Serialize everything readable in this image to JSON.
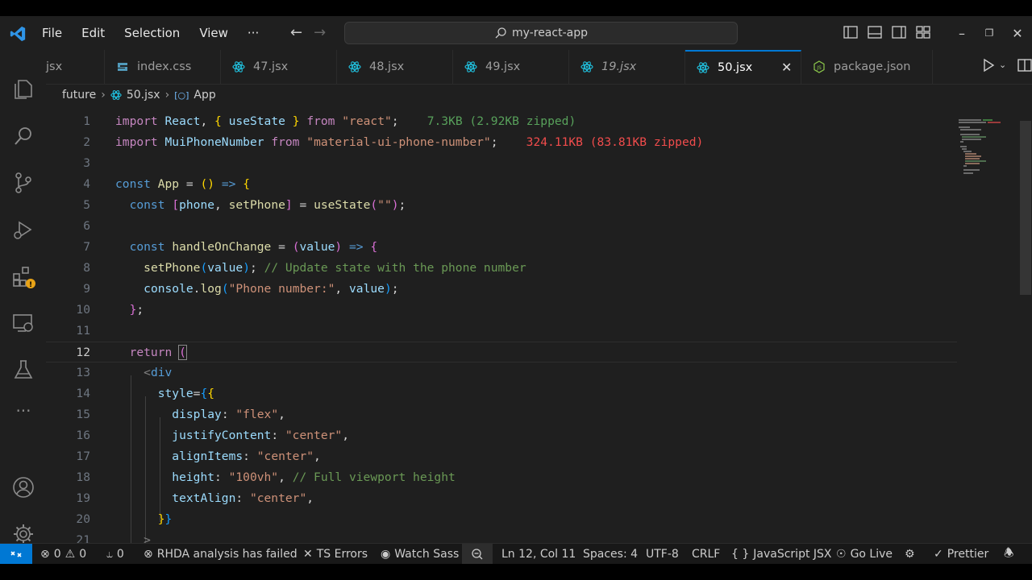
{
  "menu": [
    "File",
    "Edit",
    "Selection",
    "View",
    "···"
  ],
  "search": {
    "text": "my-react-app"
  },
  "tabs": [
    {
      "label": "jsx",
      "icon": "none"
    },
    {
      "label": "index.css",
      "icon": "css-icon"
    },
    {
      "label": "47.jsx",
      "icon": "react-icon"
    },
    {
      "label": "48.jsx",
      "icon": "react-icon"
    },
    {
      "label": "49.jsx",
      "icon": "react-icon"
    },
    {
      "label": "19.jsx",
      "icon": "react-icon"
    },
    {
      "label": "50.jsx",
      "icon": "react-icon",
      "active": true
    },
    {
      "label": "package.json",
      "icon": "nodejs-icon"
    }
  ],
  "breadcrumb": {
    "folder": "future",
    "file": "50.jsx",
    "symbol": "App"
  },
  "editor": {
    "import_sizes": {
      "line1": "7.3KB (2.92KB zipped)",
      "line2": "324.11KB (83.81KB zipped)"
    },
    "current_line": 12
  },
  "status": {
    "errors": "0",
    "warnings": "0",
    "ports": "0",
    "rhda": "RHDA analysis has failed",
    "ts_errors": "TS Errors",
    "watch_sass": "Watch Sass",
    "position": "Ln 12, Col 11",
    "spaces": "Spaces: 4",
    "encoding": "UTF-8",
    "eol": "CRLF",
    "language": "JavaScript JSX",
    "go_live": "Go Live",
    "prettier": "Prettier"
  },
  "colors": {
    "accent": "#0078d4",
    "background": "#1f1f1f"
  }
}
